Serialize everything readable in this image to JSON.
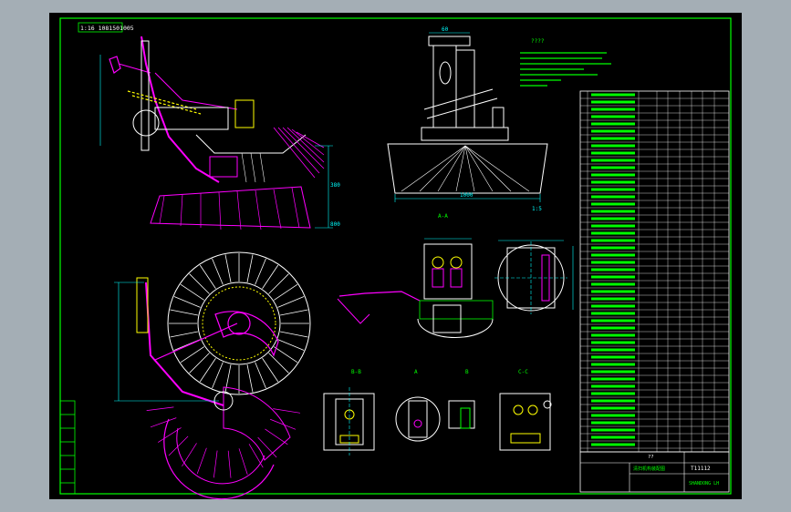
{
  "drawing": {
    "title_box_label": "1:16 1081501005",
    "note_heading": "????",
    "view_label_aa": "A-A",
    "view_label_bb": "B-B",
    "view_label_a": "A",
    "view_label_b": "B",
    "view_label_cc": "C-C",
    "dim_top": "60",
    "dim_side_1": "380",
    "dim_side_2": "800",
    "dim_bottom": "1000",
    "dim_right_view": "620",
    "scale_tag": "1:5",
    "drawing_number": "T11112",
    "title_block_name": "清扫机构装配图",
    "company": "SHANDONG LH",
    "bom_footer": "??"
  },
  "colors": {
    "background": "#000000",
    "outer_frame": "#a4aeb5",
    "border": "#00ff00",
    "outline": "#ffffff",
    "part": "#ff00ff",
    "dimension": "#00ffff",
    "accent": "#ffff00",
    "annotation": "#00ff00",
    "hidden": "#ff6060"
  }
}
